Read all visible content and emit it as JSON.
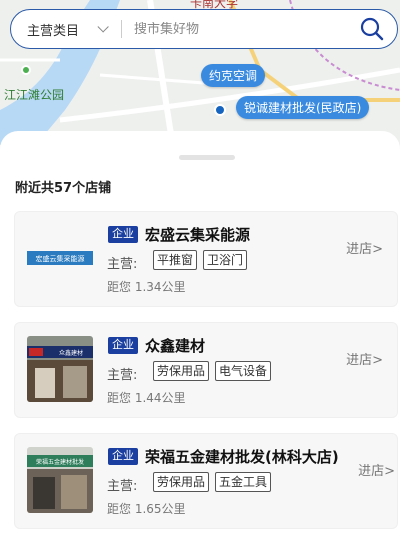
{
  "map": {
    "top_label": "卡南大学",
    "park_label": "江江滩公园",
    "ring_label": "环",
    "poi_1": "约克空调",
    "poi_2": "锐诚建材批发(民政店)"
  },
  "search": {
    "category": "主营类目",
    "placeholder": "搜市集好物"
  },
  "list": {
    "prefix": "附近共",
    "count": "57",
    "suffix": "个店铺",
    "main_label": "主营:",
    "enter_label": "进店>",
    "shops": [
      {
        "badge": "企业",
        "name": "宏盛云集采能源",
        "tags": [
          "平推窗",
          "卫浴门"
        ],
        "distance": "距您 1.34公里",
        "thumb_text": "宏盛云集采能源"
      },
      {
        "badge": "企业",
        "name": "众鑫建材",
        "tags": [
          "劳保用品",
          "电气设备"
        ],
        "distance": "距您 1.44公里",
        "thumb_text": "众鑫建材"
      },
      {
        "badge": "企业",
        "name": "荣福五金建材批发(林科大店)",
        "tags": [
          "劳保用品",
          "五金工具"
        ],
        "distance": "距您 1.65公里",
        "thumb_text": "荣福五金建材批发"
      }
    ]
  },
  "colors": {
    "accent": "#2b5aa8",
    "badge": "#1a3fa0",
    "poi": "#3a8be0"
  }
}
